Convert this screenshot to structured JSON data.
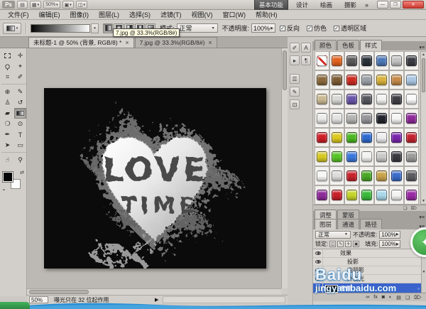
{
  "app": {
    "logo": "Ps",
    "toolbar_icons": {
      "bridge": "▤",
      "extras": "▦",
      "arrange": "▣",
      "screen_mode": "◫",
      "dropdown": "▼"
    },
    "zoom_value": "50%",
    "workspaces": [
      "基本功能",
      "设计",
      "绘画",
      "摄影"
    ],
    "workspace_more": "»",
    "window_controls": {
      "minimize": "—",
      "restore": "❐",
      "close": "✕"
    }
  },
  "menu": {
    "items": [
      "文件(F)",
      "编辑(E)",
      "图像(I)",
      "图层(L)",
      "选择(S)",
      "滤镜(T)",
      "视图(V)",
      "窗口(W)",
      "帮助(H)"
    ]
  },
  "options": {
    "mode_label": "模式:",
    "mode_value": "正常",
    "opacity_label": "不透明度:",
    "opacity_value": "100%",
    "checkboxes": [
      {
        "label": "反向",
        "checked": true
      },
      {
        "label": "仿色",
        "checked": true
      },
      {
        "label": "透明区域",
        "checked": true
      }
    ],
    "tooltip": "7.jpg @ 33.3%(RGB/8#)"
  },
  "doc_tabs": [
    {
      "label": "未标题-1 @ 50% (背景, RGB/8) *",
      "close": "×",
      "active": true
    },
    {
      "label": "7.jpg @ 33.3%(RGB/8#)",
      "close": "×",
      "active": false
    }
  ],
  "tools": [
    {
      "name": "rectangular-marquee-tool",
      "glyph": "",
      "kind": "marquee"
    },
    {
      "name": "move-tool",
      "glyph": "✛"
    },
    {
      "name": "lasso-tool",
      "glyph": "Ϙ"
    },
    {
      "name": "quick-selection-tool",
      "glyph": "⌖"
    },
    {
      "name": "crop-tool",
      "glyph": "⌗"
    },
    {
      "name": "eyedropper-tool",
      "glyph": "✐"
    },
    {
      "name": "healing-brush-tool",
      "glyph": "⊕"
    },
    {
      "name": "brush-tool",
      "glyph": "✎"
    },
    {
      "name": "clone-stamp-tool",
      "glyph": "♙"
    },
    {
      "name": "history-brush-tool",
      "glyph": "↺"
    },
    {
      "name": "eraser-tool",
      "glyph": "▰"
    },
    {
      "name": "gradient-tool",
      "glyph": "",
      "kind": "gradient",
      "selected": true
    },
    {
      "name": "blur-tool",
      "glyph": "❍"
    },
    {
      "name": "dodge-tool",
      "glyph": "⊙"
    },
    {
      "name": "pen-tool",
      "glyph": "✒"
    },
    {
      "name": "type-tool",
      "glyph": "T"
    },
    {
      "name": "path-selection-tool",
      "glyph": "➤"
    },
    {
      "name": "shape-tool",
      "glyph": "▭"
    },
    {
      "name": "hand-tool",
      "glyph": "☝"
    },
    {
      "name": "zoom-tool",
      "glyph": "⚲"
    }
  ],
  "canvas": {
    "line1": "LOVE",
    "line2": "TIME"
  },
  "dock": {
    "col1": [
      {
        "name": "history-panel",
        "glyph": "✐"
      },
      {
        "name": "actions-panel",
        "glyph": "▸"
      },
      {
        "name": "tool-presets-panel",
        "glyph": "☰"
      },
      {
        "name": "brush-presets-panel",
        "glyph": "✎"
      },
      {
        "name": "clone-source-panel",
        "glyph": "⊡"
      }
    ],
    "col2": [
      {
        "name": "character-panel",
        "glyph": "A"
      },
      {
        "name": "paragraph-panel",
        "glyph": "¶"
      }
    ]
  },
  "styles_panel": {
    "tabs": [
      {
        "label": "颜色",
        "active": false
      },
      {
        "label": "色板",
        "active": false
      },
      {
        "label": "样式",
        "active": true
      }
    ],
    "menu_icon": "▾≡",
    "footer_icons": [
      {
        "name": "new-style-button",
        "glyph": "❏"
      },
      {
        "name": "delete-style-button",
        "glyph": "⌦"
      }
    ],
    "swatches": [
      "none",
      "#e2641e",
      "#5a5a5a",
      "#2a3038",
      "#4e79b8",
      "#c2c2c2",
      "#3c3c44",
      "#8a6a3c",
      "#7c5c34",
      "#cc2b20",
      "#9aa0a6",
      "#d8b23a",
      "#c58a4a",
      "#a8c6e2",
      "#c9b992",
      "#d8d8d4",
      "#6a55a8",
      "#57575f",
      "#f2f2f0",
      "#3f3f45",
      "#fafafa",
      "#ececea",
      "#e4e4e2",
      "#b4b4b2",
      "#96969a",
      "#23242e",
      "#f6f6f4",
      "#8e2a9a",
      "#cf1f28",
      "#ddc91e",
      "#4cb822",
      "#2e6ad0",
      "#ededef",
      "#7a26ac",
      "#c42430",
      "#d6c922",
      "#57c526",
      "#3b78dc",
      "#f2f2ef",
      "#c9c9c7",
      "#3a3a40",
      "#9c9c9a",
      "#f7f7f5",
      "#dcdcda",
      "#c8232b",
      "#49a826",
      "#c9a349",
      "#3a6cc9",
      "#5c5c62",
      "#8e2a9a",
      "#c9202a",
      "#c5d42a",
      "#3bba3b",
      "#a9d8ea",
      "#f4f4f2",
      "#9a2aa5"
    ]
  },
  "adjust_tabs": [
    {
      "label": "调整",
      "active": true
    },
    {
      "label": "蒙版",
      "active": false
    }
  ],
  "layers_panel": {
    "tabs": [
      {
        "label": "图层",
        "active": true
      },
      {
        "label": "通道",
        "active": false
      },
      {
        "label": "路径",
        "active": false
      }
    ],
    "blend_mode": "正常",
    "opacity_label": "不透明度:",
    "opacity_value": "100%",
    "lock_label": "锁定:",
    "lock_icons": [
      "◫",
      "✎",
      "✛",
      "▣"
    ],
    "fill_label": "填充:",
    "fill_value": "100%",
    "rows": [
      {
        "label": "效果",
        "type": "effects"
      },
      {
        "label": "投影",
        "type": "effect"
      },
      {
        "label": "内阴影",
        "type": "effect"
      },
      {
        "label": "外发光",
        "type": "effect"
      },
      {
        "label": "背景",
        "type": "layer",
        "selected": true
      }
    ],
    "buttons": [
      {
        "name": "link-layers-button",
        "glyph": "∞"
      },
      {
        "name": "layer-style-button",
        "glyph": "fx"
      },
      {
        "name": "add-mask-button",
        "glyph": "◙"
      },
      {
        "name": "adjustment-layer-button",
        "glyph": "◐"
      },
      {
        "name": "new-group-button",
        "glyph": "▤"
      },
      {
        "name": "new-layer-button",
        "glyph": "❏"
      },
      {
        "name": "delete-layer-button",
        "glyph": "⌦"
      }
    ]
  },
  "statusbar": {
    "zoom": "50%",
    "message": "曝光只在 32 位起作用",
    "expand_icon": "▶"
  },
  "watermark": {
    "title": "Baidu",
    "url": "jingyan.baidu.com",
    "logo_glyph": "✦"
  }
}
